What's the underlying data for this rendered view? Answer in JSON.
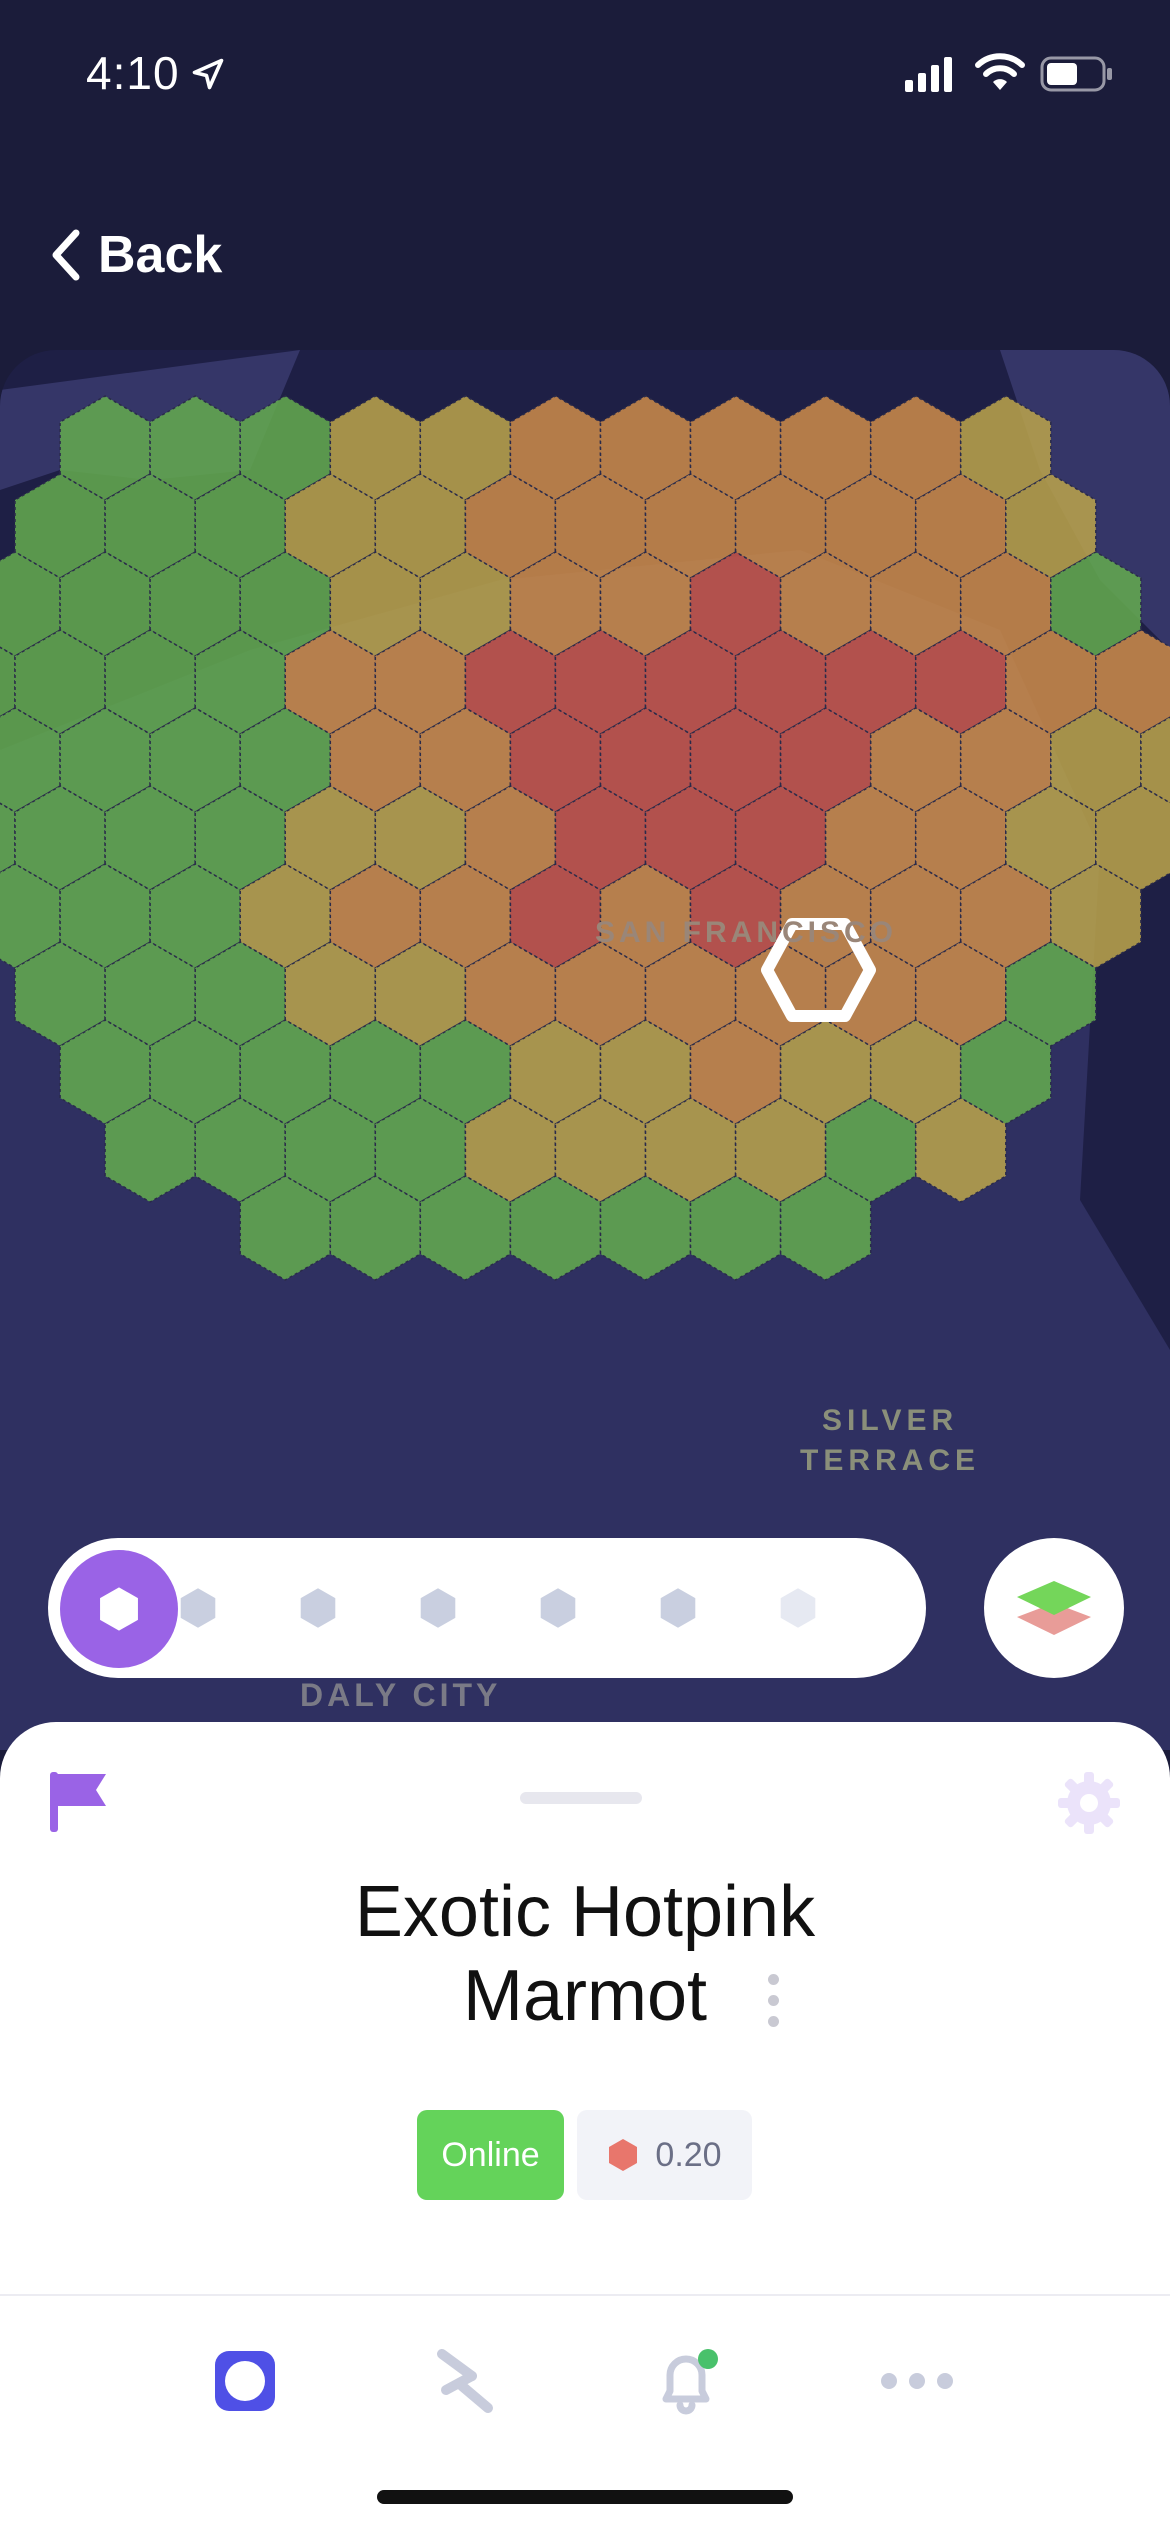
{
  "status_bar": {
    "time": "4:10",
    "icons": [
      "location-arrow-icon",
      "cellular-signal-icon",
      "wifi-icon",
      "battery-icon"
    ]
  },
  "nav": {
    "back_label": "Back"
  },
  "map": {
    "labels": [
      "SAN FRANCISCO",
      "SILVER",
      "TERRACE",
      "DALY CITY"
    ],
    "colors": {
      "background": "#1e1f45",
      "land": "#353668",
      "green": "#63a84f",
      "orange": "#c98a4a",
      "red": "#c5554a",
      "yellow": "#b8a24b"
    }
  },
  "resolution_selector": {
    "levels": 7,
    "selected_index": 0,
    "icon": "hexagon-icon"
  },
  "layers_button": {
    "icon": "layers-icon"
  },
  "hotspot": {
    "name_line1": "Exotic Hotpink",
    "name_line2": "Marmot",
    "status": "Online",
    "reward_scale": "0.20",
    "colors": {
      "online": "#64d35a",
      "reward_hex": "#e8766c",
      "accent": "#9a63e6"
    }
  },
  "tabbar": {
    "tabs": [
      {
        "name": "tab-hotspots",
        "icon": "hotspot-icon",
        "active": true
      },
      {
        "name": "tab-activity",
        "icon": "activity-icon",
        "active": false
      },
      {
        "name": "tab-notifications",
        "icon": "bell-icon",
        "active": false
      },
      {
        "name": "tab-more",
        "icon": "more-icon",
        "active": false
      }
    ]
  }
}
